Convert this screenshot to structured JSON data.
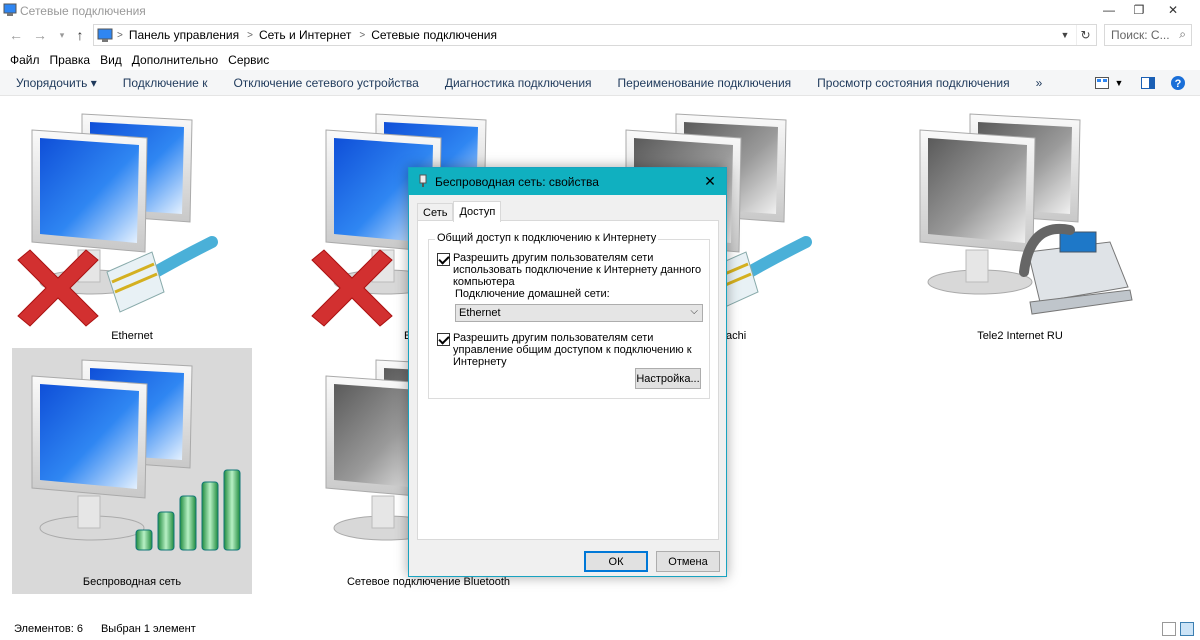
{
  "window": {
    "title": "Сетевые подключения"
  },
  "address": {
    "crumbs": [
      "Панель управления",
      "Сеть и Интернет",
      "Сетевые подключения"
    ],
    "search_placeholder": "Поиск: С..."
  },
  "menu": [
    "Файл",
    "Правка",
    "Вид",
    "Дополнительно",
    "Сервис"
  ],
  "commands": [
    "Упорядочить ▾",
    "Подключение к",
    "Отключение сетевого устройства",
    "Диагностика подключения",
    "Переименование подключения",
    "Просмотр состояния подключения",
    "»"
  ],
  "items": [
    {
      "label": "Ethernet"
    },
    {
      "label": "E"
    },
    {
      "label": "achi"
    },
    {
      "label": "Tele2 Internet RU"
    },
    {
      "label": "Беспроводная сеть"
    },
    {
      "label": "Сетевое подключение Bluetooth"
    }
  ],
  "status": {
    "count": "Элементов: 6",
    "selected": "Выбран 1 элемент"
  },
  "dialog": {
    "title": "Беспроводная сеть: свойства",
    "tabs": [
      "Сеть",
      "Доступ"
    ],
    "group_title": "Общий доступ к подключению к Интернету",
    "check1": "Разрешить другим пользователям сети использовать подключение к Интернету данного компьютера",
    "home_label": "Подключение домашней сети:",
    "home_value": "Ethernet",
    "check2": "Разрешить другим пользователям сети управление общим доступом к подключению к Интернету",
    "settings_button": "Настройка...",
    "ok_button": "ОК",
    "cancel_button": "Отмена"
  },
  "colors": {
    "dialog_title": "#10b0c0",
    "selection": "#d9d9d9",
    "cmd_text": "#1e395b"
  }
}
